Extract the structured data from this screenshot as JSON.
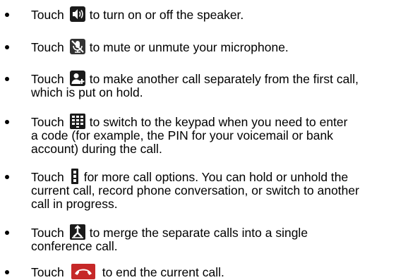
{
  "bullets": [
    {
      "icon": "speaker-icon",
      "touch": "Touch",
      "line1": "to turn on or off the speaker.",
      "line2": ""
    },
    {
      "icon": "mute-microphone-icon",
      "touch": "Touch",
      "line1": "to mute or unmute your microphone.",
      "line2": ""
    },
    {
      "icon": "add-call-icon",
      "touch": "Touch",
      "line1": "to make another call separately from the first call,",
      "line2": "which is put on hold."
    },
    {
      "icon": "keypad-icon",
      "touch": "Touch",
      "line1": "to switch to the keypad when you need to enter",
      "line2": "a code (for example, the PIN for your voicemail or bank",
      "line3": "account) during the call."
    },
    {
      "icon": "more-options-icon",
      "touch": "Touch",
      "line1": "for more call options. You can hold or unhold the",
      "line2": "current call, record phone conversation, or switch to another",
      "line3": "call in progress."
    },
    {
      "icon": "merge-calls-icon",
      "touch": "Touch",
      "line1": "to merge the separate calls into a single",
      "line2": "conference call."
    },
    {
      "icon": "end-call-icon",
      "touch": "Touch",
      "line1": "to end the current call.",
      "line2": ""
    }
  ],
  "colors": {
    "icon_dark": "#1a1a1a",
    "end_call_red": "#c62828"
  }
}
